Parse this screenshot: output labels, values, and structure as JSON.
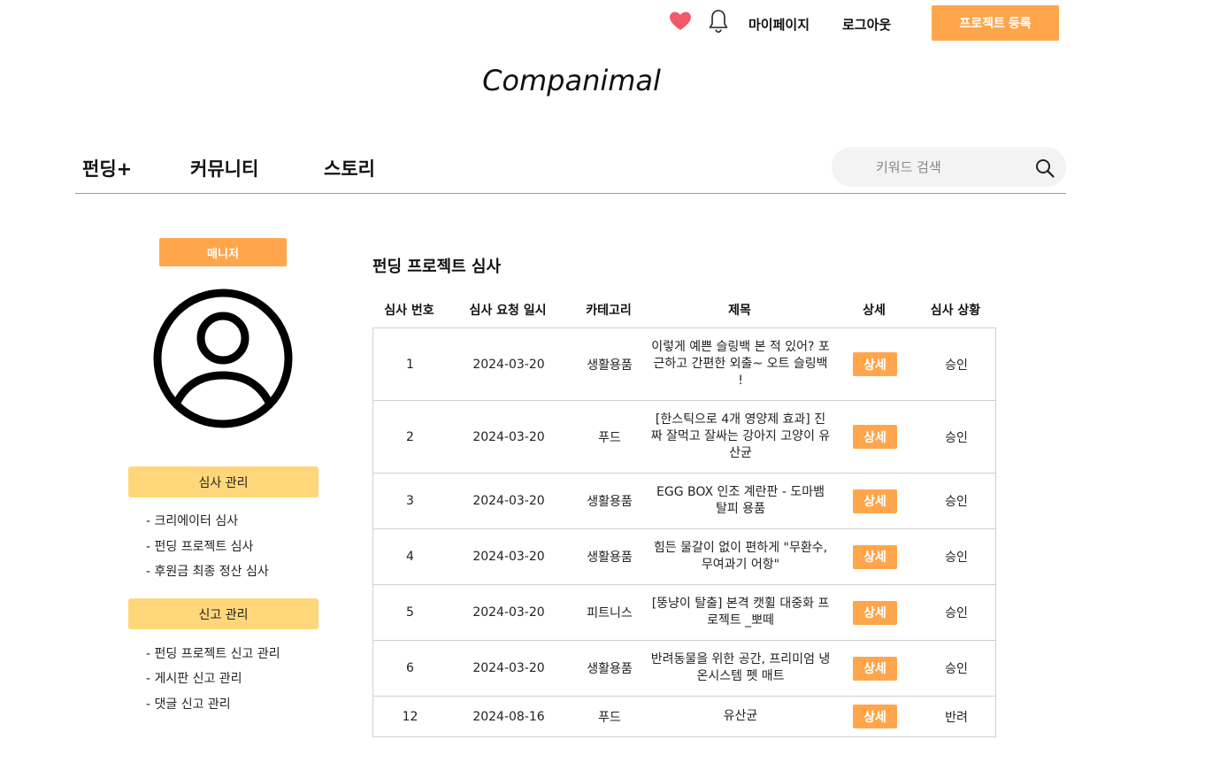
{
  "header": {
    "icons": [
      "heart-icon",
      "bell-icon"
    ],
    "mypage_label": "마이페이지",
    "logout_label": "로그아웃",
    "register_label": "프로젝트 등록",
    "logo": "Companimal"
  },
  "nav": {
    "funding": "펀딩+",
    "community": "커뮤니티",
    "story": "스토리",
    "search_placeholder": "키워드 검색"
  },
  "sidebar": {
    "role": "매니저",
    "review_header": "심사 관리",
    "review_links": [
      "- 크리에이터 심사",
      "- 펀딩 프로젝트 심사",
      "- 후원금 최종 정산 심사"
    ],
    "report_header": "신고 관리",
    "report_links": [
      "- 펀딩 프로젝트 신고 관리",
      "- 게시판 신고 관리",
      "- 댓글 신고 관리"
    ]
  },
  "main": {
    "title": "펀딩 프로젝트 심사",
    "columns": [
      "심사 번호",
      "심사 요청 일시",
      "카테고리",
      "제목",
      "상세",
      "심사 상황"
    ],
    "detail_label": "상세",
    "rows": [
      {
        "no": "1",
        "date": "2024-03-20",
        "category": "생활용품",
        "title": "이렇게 예쁜 슬링백 본 적 있어? 포근하고 간편한 외출~ 오트 슬링백 !",
        "status": "승인"
      },
      {
        "no": "2",
        "date": "2024-03-20",
        "category": "푸드",
        "title": "[한스틱으로 4개 영양제 효과] 진짜 잘먹고 잘싸는 강아지 고양이 유산균",
        "status": "승인"
      },
      {
        "no": "3",
        "date": "2024-03-20",
        "category": "생활용품",
        "title": "EGG BOX 인조 계란판 - 도마뱀 탈피 용품",
        "status": "승인"
      },
      {
        "no": "4",
        "date": "2024-03-20",
        "category": "생활용품",
        "title": "힘든 물갈이 없이 편하게 \"무환수,무여과기 어항\"",
        "status": "승인"
      },
      {
        "no": "5",
        "date": "2024-03-20",
        "category": "피트니스",
        "title": "[뚱냥이 탈출] 본격 캣휠 대중화 프로젝트 _뽀떼",
        "status": "승인"
      },
      {
        "no": "6",
        "date": "2024-03-20",
        "category": "생활용품",
        "title": "반려동물을 위한 공간, 프리미엄 냉온시스템 펫 매트",
        "status": "승인"
      },
      {
        "no": "12",
        "date": "2024-08-16",
        "category": "푸드",
        "title": "유산균",
        "status": "반려"
      }
    ]
  },
  "colors": {
    "accent": "#ffa64d",
    "side_header": "#ffd77a",
    "heart": "#f25a6a"
  }
}
